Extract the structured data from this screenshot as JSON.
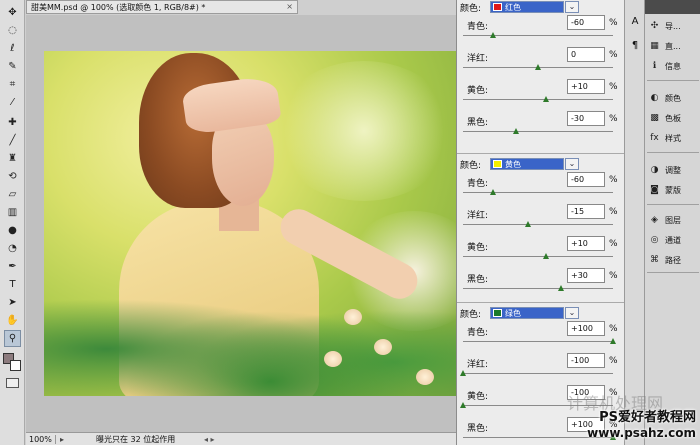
{
  "document": {
    "title": "甜美MM.psd @ 100% (选取颜色 1, RGB/8#) *",
    "close": "×"
  },
  "statusbar": {
    "zoom": "100%",
    "info": "曝光只在 32 位起作用"
  },
  "toolbox": {
    "tools": [
      "move-icon",
      "marquee-icon",
      "lasso-icon",
      "quick-select-icon",
      "crop-icon",
      "eyedropper-icon",
      "healing-icon",
      "brush-icon",
      "stamp-icon",
      "history-brush-icon",
      "eraser-icon",
      "gradient-icon",
      "blur-icon",
      "dodge-icon",
      "pen-icon",
      "type-icon",
      "path-select-icon",
      "shape-icon",
      "hand-icon",
      "zoom-icon"
    ],
    "foreground_color": "#8c7b7e",
    "background_color": "#ffffff"
  },
  "selective_color": {
    "groups": [
      {
        "label": "颜色:",
        "color_name": "红色",
        "swatch": "#e01818",
        "sliders": [
          {
            "label": "青色:",
            "value": "-60",
            "unit": "%",
            "pos": 0.2
          },
          {
            "label": "洋红:",
            "value": "0",
            "unit": "%",
            "pos": 0.5
          },
          {
            "label": "黄色:",
            "value": "+10",
            "unit": "%",
            "pos": 0.55
          },
          {
            "label": "黑色:",
            "value": "-30",
            "unit": "%",
            "pos": 0.35
          }
        ]
      },
      {
        "label": "颜色:",
        "color_name": "黄色",
        "swatch": "#f5f000",
        "sliders": [
          {
            "label": "青色:",
            "value": "-60",
            "unit": "%",
            "pos": 0.2
          },
          {
            "label": "洋红:",
            "value": "-15",
            "unit": "%",
            "pos": 0.43
          },
          {
            "label": "黄色:",
            "value": "+10",
            "unit": "%",
            "pos": 0.55
          },
          {
            "label": "黑色:",
            "value": "+30",
            "unit": "%",
            "pos": 0.65
          }
        ]
      },
      {
        "label": "颜色:",
        "color_name": "绿色",
        "swatch": "#1a7a2a",
        "sliders": [
          {
            "label": "青色:",
            "value": "+100",
            "unit": "%",
            "pos": 1.0
          },
          {
            "label": "洋红:",
            "value": "-100",
            "unit": "%",
            "pos": 0.0
          },
          {
            "label": "黄色:",
            "value": "-100",
            "unit": "%",
            "pos": 0.0
          },
          {
            "label": "黑色:",
            "value": "+100",
            "unit": "%",
            "pos": 1.0
          }
        ]
      }
    ]
  },
  "dock": {
    "items": [
      {
        "label": "导...",
        "icon": "navigator-icon"
      },
      {
        "label": "直...",
        "icon": "histogram-icon"
      },
      {
        "label": "信息",
        "icon": "info-icon"
      },
      {
        "label": "颜色",
        "icon": "color-icon"
      },
      {
        "label": "色板",
        "icon": "swatches-icon"
      },
      {
        "label": "样式",
        "icon": "styles-icon"
      },
      {
        "label": "调整",
        "icon": "adjustments-icon"
      },
      {
        "label": "蒙版",
        "icon": "masks-icon"
      },
      {
        "label": "图层",
        "icon": "layers-icon"
      },
      {
        "label": "通道",
        "icon": "channels-icon"
      },
      {
        "label": "路径",
        "icon": "paths-icon"
      }
    ],
    "strip_icons": [
      "character-icon",
      "paragraph-icon"
    ]
  },
  "watermark": {
    "ghost": "计算机处理网",
    "line1": "PS爱好者教程网",
    "line2": "www.psahz.com"
  }
}
